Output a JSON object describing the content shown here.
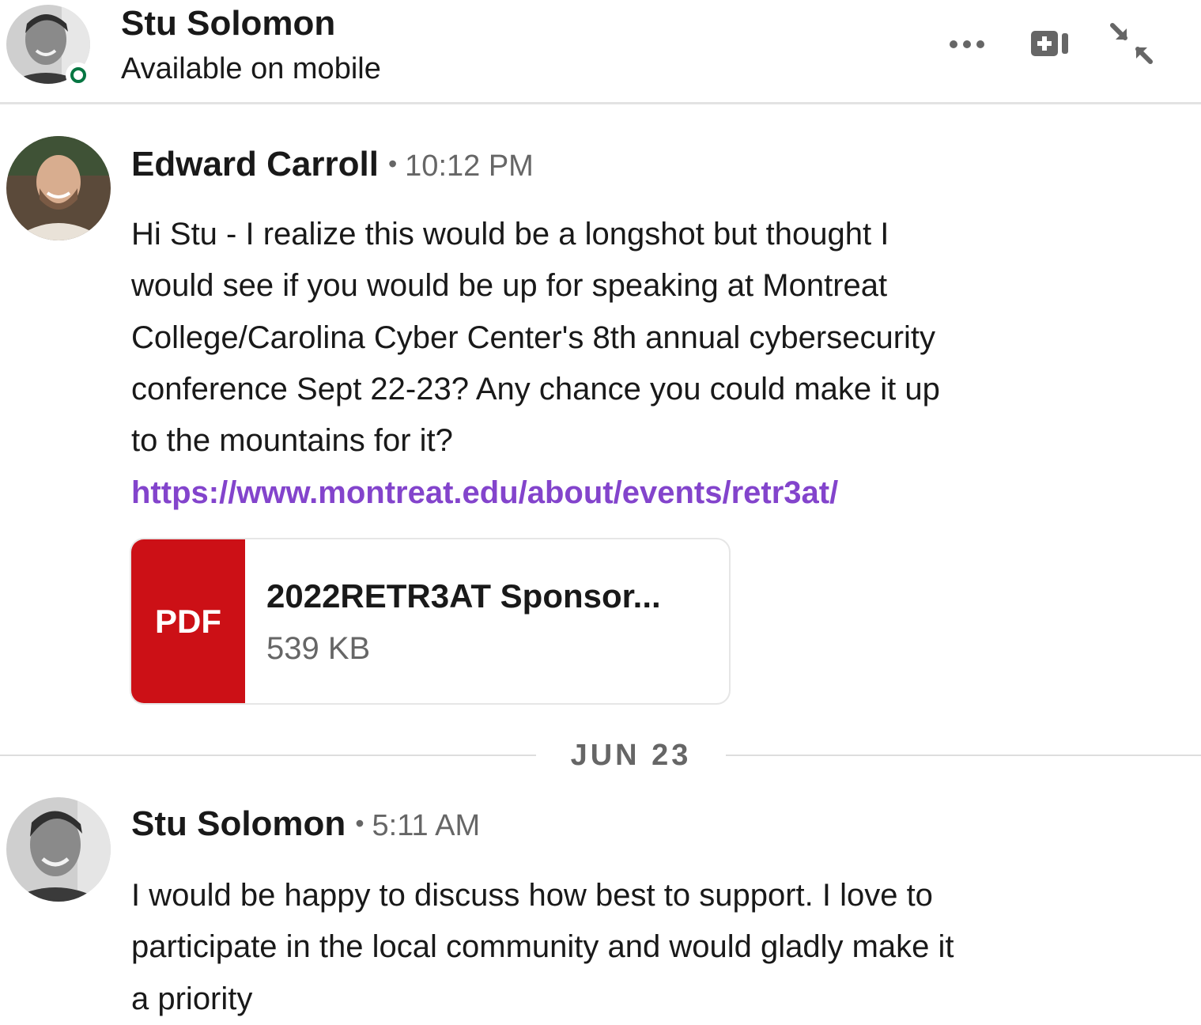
{
  "header": {
    "name": "Stu Solomon",
    "status": "Available on mobile",
    "presence_color": "#057642",
    "actions": [
      {
        "icon": "more-icon",
        "label": "More options"
      },
      {
        "icon": "video-call-icon",
        "label": "Video call"
      },
      {
        "icon": "collapse-icon",
        "label": "Collapse conversation"
      }
    ]
  },
  "messages": [
    {
      "sender": "Edward Carroll",
      "separator": "•",
      "time": "10:12 PM",
      "text": "Hi Stu - I realize this would be a longshot but thought I\nwould see if you would be up for speaking at Montreat\nCollege/Carolina Cyber Center's 8th annual cybersecurity\nconference Sept 22-23? Any chance you could make it up\nto the mountains for it?",
      "link": "https://www.montreat.edu/about/events/retr3at/",
      "attachment": {
        "type_label": "PDF",
        "name": "2022RETR3AT Sponsor...",
        "size": "539 KB"
      }
    },
    {
      "sender": "Stu Solomon",
      "separator": "•",
      "time": "5:11 AM",
      "text": "I would be happy to discuss how best to support. I love to\nparticipate in the local community and would gladly make it\na priority"
    }
  ],
  "date_divider": "JUN 23",
  "colors": {
    "link": "#8344cc",
    "pdf_tile": "#cc1016",
    "presence": "#057642"
  }
}
